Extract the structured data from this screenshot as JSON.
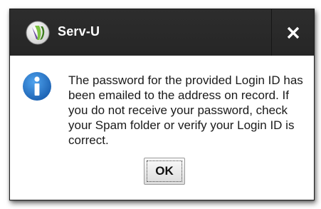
{
  "window": {
    "title": "Serv-U",
    "logo_icon": "serv-u-logo-icon",
    "close_icon": "close-icon"
  },
  "dialog": {
    "icon": "info-icon",
    "message": "The password for the provided Login ID has been emailed to the address on record. If you do not receive your password, check your Spam folder or verify your Login ID is correct.",
    "ok_label": "OK"
  },
  "colors": {
    "titlebar": "#2a2a2a",
    "title_text": "#ffffff",
    "info_blue": "#2a7fd0",
    "logo_green": "#7cc242",
    "logo_purple": "#6b4aa0"
  }
}
